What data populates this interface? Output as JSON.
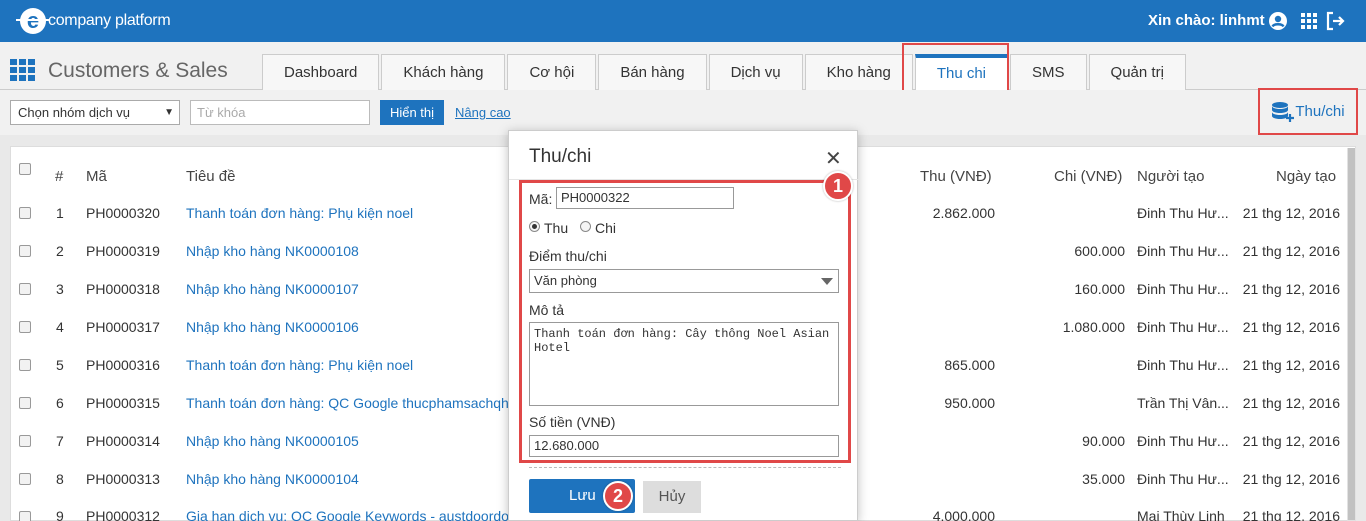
{
  "topbar": {
    "logo_text": "company platform",
    "greeting": "Xin chào: linhmt"
  },
  "header": {
    "app_title": "Customers & Sales",
    "tabs": [
      "Dashboard",
      "Khách hàng",
      "Cơ hội",
      "Bán hàng",
      "Dịch vụ",
      "Kho hàng",
      "Thu chi",
      "SMS",
      "Quản trị"
    ],
    "active_tab": "Thu chi"
  },
  "filter": {
    "group_select": "Chọn nhóm dịch vụ",
    "keyword_placeholder": "Từ khóa",
    "show_button": "Hiển thị",
    "advanced_link": "Nâng cao",
    "add_button": "Thu/chi"
  },
  "table": {
    "headers": {
      "num": "#",
      "code": "Mã",
      "title": "Tiêu đề",
      "income": "Thu (VNĐ)",
      "expense": "Chi (VNĐ)",
      "creator": "Người tạo",
      "date": "Ngày tạo"
    },
    "rows": [
      {
        "num": "1",
        "code": "PH0000320",
        "title": "Thanh toán đơn hàng: Phụ kiện noel",
        "income": "2.862.000",
        "expense": "",
        "creator": "Đinh Thu Hư...",
        "date": "21 thg 12, 2016"
      },
      {
        "num": "2",
        "code": "PH0000319",
        "title": "Nhập kho hàng NK0000108",
        "income": "",
        "expense": "600.000",
        "creator": "Đinh Thu Hư...",
        "date": "21 thg 12, 2016"
      },
      {
        "num": "3",
        "code": "PH0000318",
        "title": "Nhập kho hàng NK0000107",
        "income": "",
        "expense": "160.000",
        "creator": "Đinh Thu Hư...",
        "date": "21 thg 12, 2016"
      },
      {
        "num": "4",
        "code": "PH0000317",
        "title": "Nhập kho hàng NK0000106",
        "income": "",
        "expense": "1.080.000",
        "creator": "Đinh Thu Hư...",
        "date": "21 thg 12, 2016"
      },
      {
        "num": "5",
        "code": "PH0000316",
        "title": "Thanh toán đơn hàng: Phụ kiện noel",
        "income": "865.000",
        "expense": "",
        "creator": "Đinh Thu Hư...",
        "date": "21 thg 12, 2016"
      },
      {
        "num": "6",
        "code": "PH0000315",
        "title": "Thanh toán đơn hàng: QC Google thucphamsachqh.",
        "income": "950.000",
        "expense": "",
        "creator": "Trần Thị Vân...",
        "date": "21 thg 12, 2016"
      },
      {
        "num": "7",
        "code": "PH0000314",
        "title": "Nhập kho hàng NK0000105",
        "income": "",
        "expense": "90.000",
        "creator": "Đinh Thu Hư...",
        "date": "21 thg 12, 2016"
      },
      {
        "num": "8",
        "code": "PH0000313",
        "title": "Nhập kho hàng NK0000104",
        "income": "",
        "expense": "35.000",
        "creator": "Đinh Thu Hư...",
        "date": "21 thg 12, 2016"
      },
      {
        "num": "9",
        "code": "PH0000312",
        "title": "Gia hạn dịch vụ: QC Google Keywords - austdoordon",
        "income": "4.000.000",
        "expense": "",
        "creator": "Mai Thùy Linh",
        "date": "21 thg 12, 2016"
      }
    ]
  },
  "modal": {
    "title": "Thu/chi",
    "code_label": "Mã:",
    "code_value": "PH0000322",
    "radio_thu": "Thu",
    "radio_chi": "Chi",
    "point_label": "Điểm thu/chi",
    "point_value": "Văn phòng",
    "desc_label": "Mô tả",
    "desc_value": "Thanh toán đơn hàng: Cây thông Noel Asian Hotel",
    "amount_label": "Số tiền (VNĐ)",
    "amount_value": "12.680.000",
    "save_button": "Lưu",
    "cancel_button": "Hủy",
    "badge_1": "1",
    "badge_2": "2"
  },
  "colors": {
    "brand": "#1e73be",
    "highlight": "#e04848"
  }
}
